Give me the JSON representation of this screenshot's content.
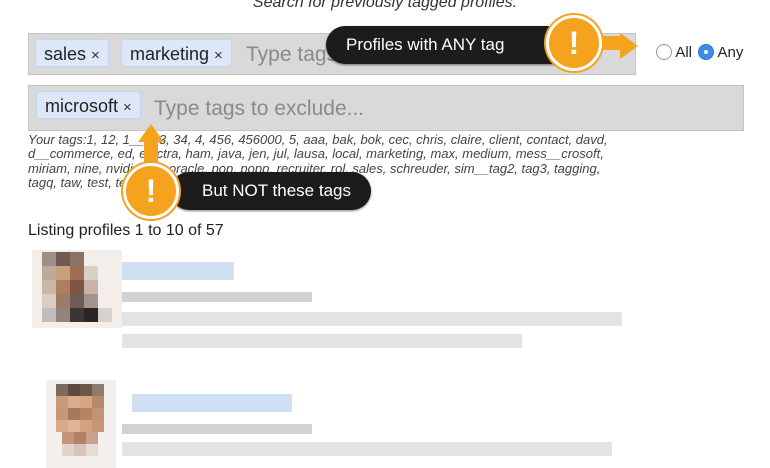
{
  "header": {
    "title": "Search for previously tagged profiles."
  },
  "include": {
    "chips": [
      "sales",
      "marketing"
    ],
    "remove_glyph": "×",
    "placeholder": "Type tags to include..."
  },
  "exclude": {
    "chips": [
      "microsoft"
    ],
    "remove_glyph": "×",
    "placeholder": "Type tags to exclude..."
  },
  "match_mode": {
    "all_label": "All",
    "any_label": "Any",
    "selected": "Any"
  },
  "your_tags": {
    "label": "Your tags:",
    "visible_text": "Your tags:1, 12, 1__2, 3, 34, 4, 456, 456000, 5, aaa, bak, bok, cec, chris, claire, client, contact, davd, d__commerce, ed, electra, ham, java, jen, jul, lausa, local, marketing, max, medium, mess__crosoft, miriam, nine, nvidia, oo, oracle, pop, popp, recruiter, rol, sales, schreuder, sim__tag2, tag3, tagging, tagq, taw, test, testtag, tttt, ve"
  },
  "listing": {
    "summary": "Listing profiles 1 to 10 of 57"
  },
  "callouts": {
    "include_tip": "Profiles with ANY tag",
    "exclude_tip": "But NOT these tags",
    "badge_glyph": "!"
  },
  "colors": {
    "accent_orange": "#f5a21f",
    "callout_bg": "#1c1c1c",
    "chip_bg": "#dde7f7",
    "field_bg": "#d9d9d9",
    "radio_selected": "#3b8ee8"
  },
  "icons": {
    "remove_chip": "close-icon",
    "alert": "exclamation-icon"
  }
}
